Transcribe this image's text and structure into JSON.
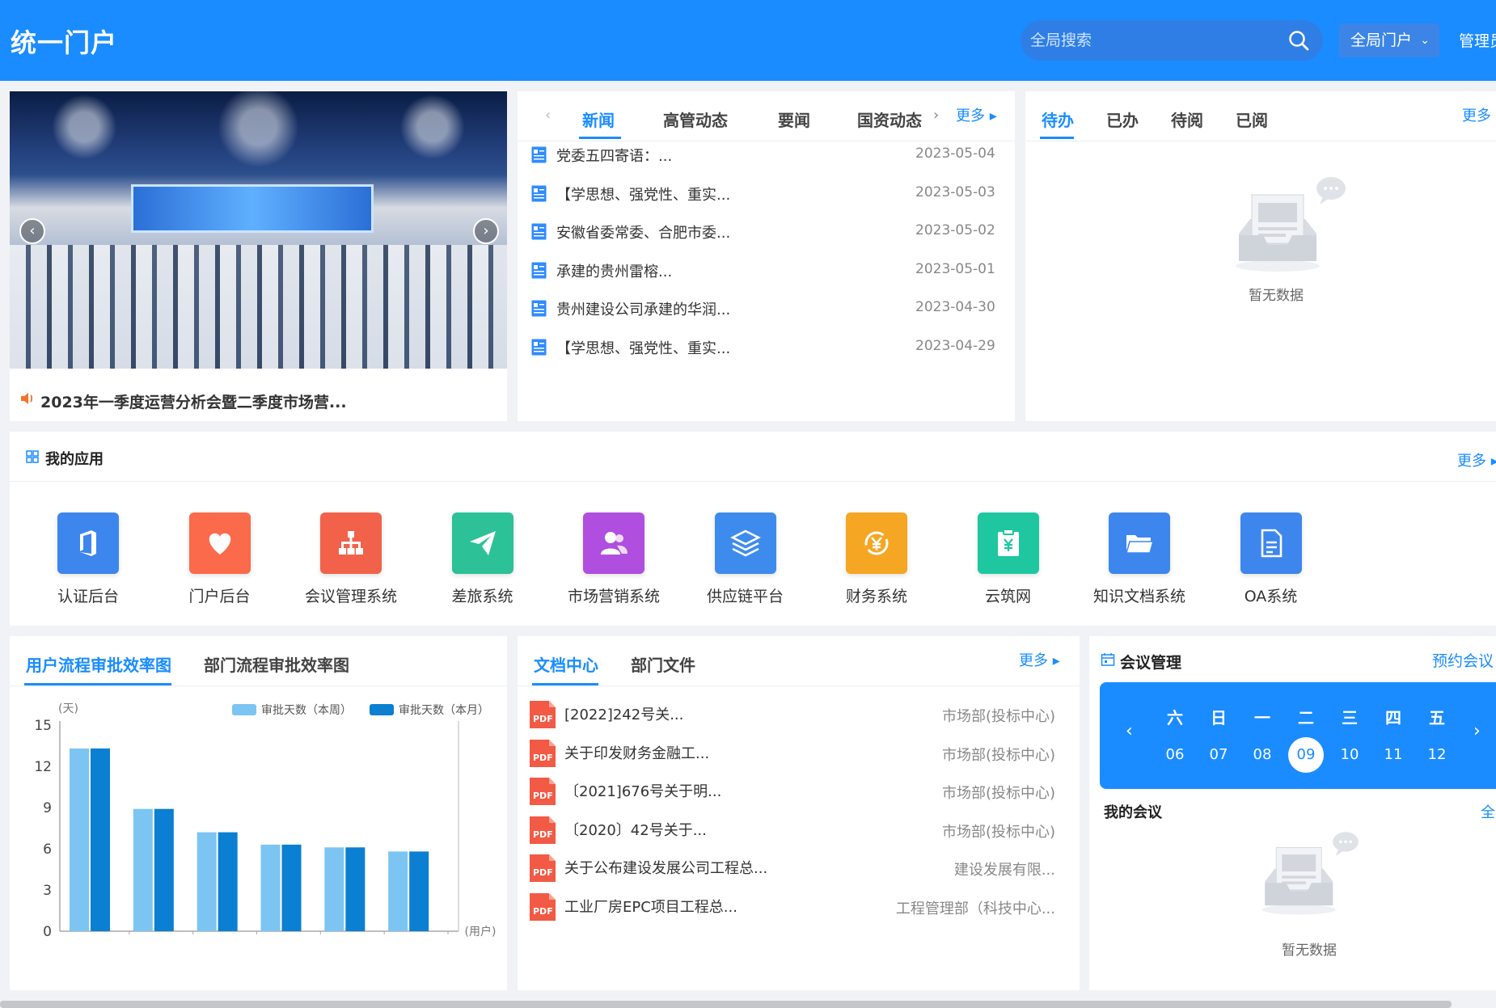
{
  "header": {
    "logo": "统一门户",
    "search_placeholder": "全局搜索",
    "portal_label": "全局门户",
    "admin_label": "管理员"
  },
  "carousel": {
    "caption": "2023年一季度运营分析会暨二季度市场营..."
  },
  "news": {
    "tabs": [
      "新闻",
      "高管动态",
      "要闻",
      "国资动态"
    ],
    "more": "更多",
    "items": [
      {
        "title": "党委五四寄语：...",
        "date": "2023-05-04"
      },
      {
        "title": "【学思想、强党性、重实...",
        "date": "2023-05-03"
      },
      {
        "title": "安徽省委常委、合肥市委...",
        "date": "2023-05-02"
      },
      {
        "title": "承建的贵州雷榕...",
        "date": "2023-05-01"
      },
      {
        "title": "贵州建设公司承建的华润...",
        "date": "2023-04-30"
      },
      {
        "title": "【学思想、强党性、重实...",
        "date": "2023-04-29"
      }
    ]
  },
  "tasks": {
    "tabs": [
      "待办",
      "已办",
      "待阅",
      "已阅"
    ],
    "more": "更多",
    "empty": "暂无数据"
  },
  "apps": {
    "title": "我的应用",
    "more": "更多",
    "items": [
      {
        "label": "认证后台",
        "icon": "office-icon",
        "color": "#3d86ee"
      },
      {
        "label": "门户后台",
        "icon": "heart-icon",
        "color": "#fb6a4a"
      },
      {
        "label": "会议管理系统",
        "icon": "org-chart-icon",
        "color": "#f2624a"
      },
      {
        "label": "差旅系统",
        "icon": "paper-plane-icon",
        "color": "#2cc197"
      },
      {
        "label": "市场营销系统",
        "icon": "users-icon",
        "color": "#b04ee0"
      },
      {
        "label": "供应链平台",
        "icon": "layers-icon",
        "color": "#3e8bee"
      },
      {
        "label": "财务系统",
        "icon": "yuan-cycle-icon",
        "color": "#f5a623"
      },
      {
        "label": "云筑网",
        "icon": "clipboard-yuan-icon",
        "color": "#1fc7a0"
      },
      {
        "label": "知识文档系统",
        "icon": "folder-icon",
        "color": "#3d86ee"
      },
      {
        "label": "OA系统",
        "icon": "document-icon",
        "color": "#3d86ee"
      }
    ]
  },
  "chart_tabs": [
    "用户流程审批效率图",
    "部门流程审批效率图"
  ],
  "chart_data": {
    "type": "bar",
    "ylabel": "(天)",
    "xlabel": "(用户)",
    "ylim": [
      0,
      15
    ],
    "yticks": [
      0,
      3,
      6,
      9,
      12,
      15
    ],
    "categories": [
      "",
      "",
      "",
      "",
      "",
      ""
    ],
    "series": [
      {
        "name": "审批天数（本周）",
        "color": "#7cc5f2",
        "values": [
          13.3,
          8.9,
          7.2,
          6.3,
          6.1,
          5.8
        ]
      },
      {
        "name": "审批天数（本月）",
        "color": "#0b7fd1",
        "values": [
          13.3,
          8.9,
          7.2,
          6.3,
          6.1,
          5.8
        ]
      }
    ],
    "legend": "top-right",
    "grid": false
  },
  "docs": {
    "tabs": [
      "文档中心",
      "部门文件"
    ],
    "more": "更多",
    "items": [
      {
        "title": "[2022]242号关...",
        "dept": "市场部(投标中心)"
      },
      {
        "title": "关于印发财务金融工...",
        "dept": "市场部(投标中心)"
      },
      {
        "title": "〔2021]676号关于明...",
        "dept": "市场部(投标中心)"
      },
      {
        "title": "〔2020〕42号关于...",
        "dept": "市场部(投标中心)"
      },
      {
        "title": "关于公布建设发展公司工程总...",
        "dept": "建设发展有限..."
      },
      {
        "title": "工业厂房EPC项目工程总...",
        "dept": "工程管理部（科技中心..."
      }
    ],
    "pdf_label": "PDF"
  },
  "meetings": {
    "title": "会议管理",
    "book": "预约会议",
    "weekdays": [
      "六",
      "日",
      "一",
      "二",
      "三",
      "四",
      "五"
    ],
    "days": [
      "06",
      "07",
      "08",
      "09",
      "10",
      "11",
      "12"
    ],
    "selected_index": 3,
    "my_title": "我的会议",
    "all": "全部",
    "empty": "暂无数据"
  }
}
